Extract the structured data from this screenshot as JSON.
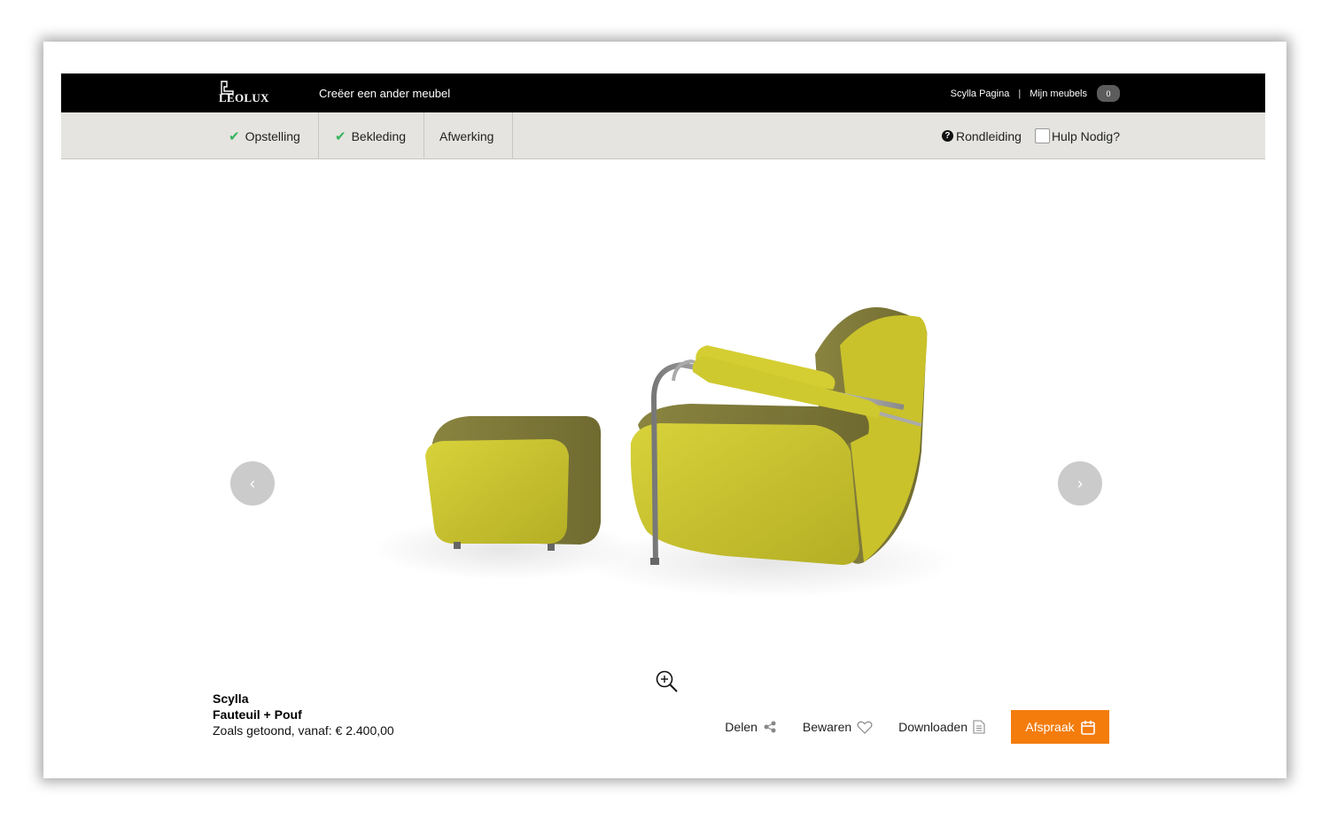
{
  "header": {
    "logo_text": "LEOLUX",
    "create_link": "Creëer een ander meubel",
    "model_page": "Scylla Pagina",
    "separator": "|",
    "my_furniture": "Mijn meubels",
    "cart_count": "0"
  },
  "steps": [
    {
      "label": "Opstelling",
      "completed": true
    },
    {
      "label": "Bekleding",
      "completed": true
    },
    {
      "label": "Afwerking",
      "completed": false
    }
  ],
  "nav_right": {
    "tour_label": "Rondleiding",
    "help_label": "Hulp Nodig?"
  },
  "carousel": {
    "prev_icon": "chevron-left-icon",
    "next_icon": "chevron-right-icon",
    "prev_glyph": "‹",
    "next_glyph": "›"
  },
  "product": {
    "name": "Scylla",
    "type": "Fauteuil + Pouf",
    "price_text": "Zoals getoond, vanaf: € 2.400,00"
  },
  "actions": {
    "share": "Delen",
    "save": "Bewaren",
    "download": "Downloaden",
    "appointment": "Afspraak"
  },
  "colors": {
    "accent_orange": "#f47c0d",
    "check_green": "#35b35b",
    "nav_bg": "#e5e4e0",
    "upholstery_yellow": "#c8c22c",
    "upholstery_olive": "#7f7a3a"
  }
}
